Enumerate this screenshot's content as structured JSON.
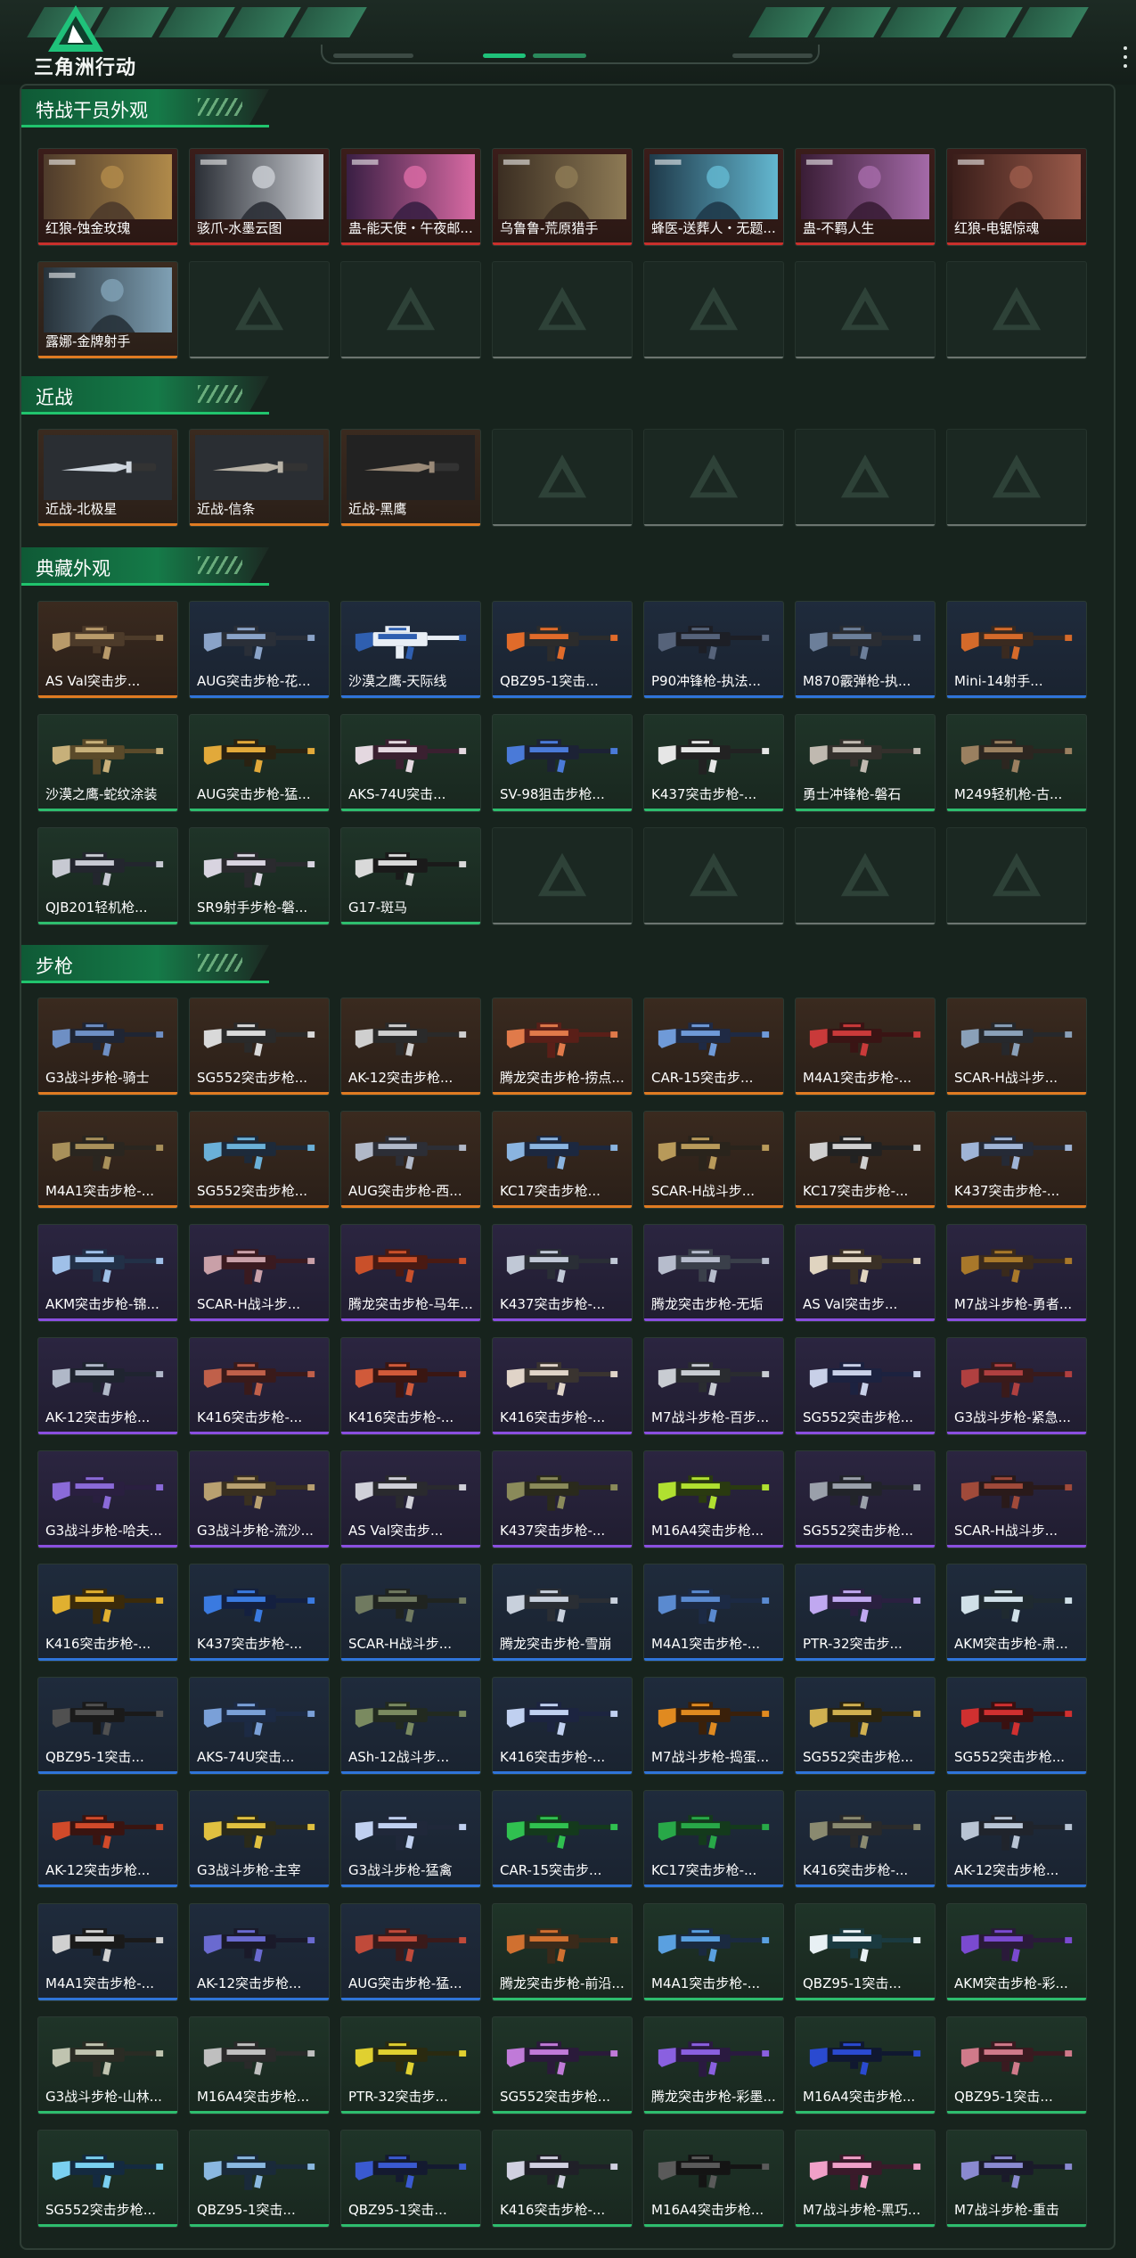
{
  "app": {
    "logo_text": "三角洲行动"
  },
  "sections": [
    {
      "title": "特战干员外观",
      "kind": "portrait",
      "items": [
        {
          "name": "红狼-蚀金玫瑰",
          "rarity": "red",
          "palette": [
            "#4e3b2b",
            "#b08a4a"
          ]
        },
        {
          "name": "骇爪-水墨云图",
          "rarity": "red",
          "palette": [
            "#2b2f36",
            "#c9ccd2"
          ]
        },
        {
          "name": "蛊-能天使・午夜邮...",
          "rarity": "red",
          "palette": [
            "#3a1f44",
            "#d86aa3"
          ]
        },
        {
          "name": "乌鲁鲁-荒原猎手",
          "rarity": "red",
          "palette": [
            "#3b2e22",
            "#8d7a55"
          ]
        },
        {
          "name": "蜂医-送葬人・无题...",
          "rarity": "red",
          "palette": [
            "#1f3a4a",
            "#63b7d0"
          ]
        },
        {
          "name": "蛊-不羁人生",
          "rarity": "red",
          "palette": [
            "#3a1d36",
            "#a46aa8"
          ]
        },
        {
          "name": "红狼-电锯惊魂",
          "rarity": "red",
          "palette": [
            "#3a1e1a",
            "#9a5a4a"
          ]
        },
        {
          "name": "露娜-金牌射手",
          "rarity": "orange",
          "palette": [
            "#27323a",
            "#7fa0b4"
          ]
        }
      ],
      "slots": 14
    },
    {
      "title": "近战",
      "kind": "knife",
      "items": [
        {
          "name": "近战-北极星",
          "rarity": "orange",
          "palette": [
            "#2a2e33",
            "#cfd6de"
          ]
        },
        {
          "name": "近战-信条",
          "rarity": "orange",
          "palette": [
            "#2a2e33",
            "#b8b2a6"
          ]
        },
        {
          "name": "近战-黑鹰",
          "rarity": "orange",
          "palette": [
            "#222",
            "#9a8a78"
          ]
        }
      ],
      "slots": 7
    },
    {
      "title": "典藏外观",
      "kind": "gun",
      "items": [
        {
          "name": "AS Val突击步...",
          "rarity": "orange",
          "palette": [
            "#4d3b2a",
            "#b89a6a"
          ]
        },
        {
          "name": "AUG突击步枪-花...",
          "rarity": "blue",
          "palette": [
            "#2a2f38",
            "#8aa3c8"
          ]
        },
        {
          "name": "沙漠之鹰-天际线",
          "rarity": "blue",
          "palette": [
            "#e8eef5",
            "#2f5fb0"
          ]
        },
        {
          "name": "QBZ95-1突击...",
          "rarity": "blue",
          "palette": [
            "#2c2c2c",
            "#e06b2a"
          ]
        },
        {
          "name": "P90冲锋枪-执法...",
          "rarity": "blue",
          "palette": [
            "#1d1f26",
            "#56637a"
          ]
        },
        {
          "name": "M870霰弹枪-执...",
          "rarity": "blue",
          "palette": [
            "#2a2d33",
            "#6c7f9a"
          ]
        },
        {
          "name": "Mini-14射手...",
          "rarity": "blue",
          "palette": [
            "#3a2a20",
            "#d46a2a"
          ]
        },
        {
          "name": "沙漠之鹰-蛇纹涂装",
          "rarity": "green",
          "palette": [
            "#5a4a2a",
            "#c7b07a"
          ]
        },
        {
          "name": "AUG突击步枪-猛...",
          "rarity": "green",
          "palette": [
            "#2a2212",
            "#e2a93a"
          ]
        },
        {
          "name": "AKS-74U突击...",
          "rarity": "green",
          "palette": [
            "#3a2030",
            "#e4d8e0"
          ]
        },
        {
          "name": "SV-98狙击步枪...",
          "rarity": "green",
          "palette": [
            "#1c2235",
            "#4a7ad8"
          ]
        },
        {
          "name": "K437突击步枪-...",
          "rarity": "green",
          "palette": [
            "#222",
            "#e6e6e6"
          ]
        },
        {
          "name": "勇士冲锋枪-磐石",
          "rarity": "green",
          "palette": [
            "#34302c",
            "#c0b9b0"
          ]
        },
        {
          "name": "M249轻机枪-古...",
          "rarity": "green",
          "palette": [
            "#2c2620",
            "#9a8060"
          ]
        },
        {
          "name": "QJB201轻机枪...",
          "rarity": "green",
          "palette": [
            "#23262e",
            "#c7c9d2"
          ]
        },
        {
          "name": "SR9射手步枪-磐...",
          "rarity": "green",
          "palette": [
            "#2a2a2e",
            "#d8d4e0"
          ]
        },
        {
          "name": "G17-斑马",
          "rarity": "green",
          "palette": [
            "#1a1a1a",
            "#d9d9d9"
          ]
        }
      ],
      "slots": 21
    },
    {
      "title": "步枪",
      "kind": "gun",
      "items": [
        {
          "name": "G3战斗步枪-骑士",
          "rarity": "orange",
          "palette": [
            "#1f2533",
            "#6e8fc4"
          ]
        },
        {
          "name": "SG552突击步枪...",
          "rarity": "orange",
          "palette": [
            "#2a2a2a",
            "#d9d9d9"
          ]
        },
        {
          "name": "AK-12突击步枪...",
          "rarity": "orange",
          "palette": [
            "#2a2a2a",
            "#cfcfcf"
          ]
        },
        {
          "name": "腾龙突击步枪-捞点...",
          "rarity": "orange",
          "palette": [
            "#5a1f18",
            "#e07a4a"
          ]
        },
        {
          "name": "CAR-15突击步...",
          "rarity": "orange",
          "palette": [
            "#1f2a44",
            "#6f9ad8"
          ]
        },
        {
          "name": "M4A1突击步枪-...",
          "rarity": "orange",
          "palette": [
            "#3a1414",
            "#c93a3a"
          ]
        },
        {
          "name": "SCAR-H战斗步...",
          "rarity": "orange",
          "palette": [
            "#26282c",
            "#8aa0b8"
          ]
        },
        {
          "name": "M4A1突击步枪-...",
          "rarity": "orange",
          "palette": [
            "#2a2620",
            "#a8905a"
          ]
        },
        {
          "name": "SG552突击步枪...",
          "rarity": "orange",
          "palette": [
            "#1d2a3a",
            "#6ab0d8"
          ]
        },
        {
          "name": "AUG突击步枪-西...",
          "rarity": "orange",
          "palette": [
            "#2c2e36",
            "#b0b8c8"
          ]
        },
        {
          "name": "KC17突击步枪...",
          "rarity": "orange",
          "palette": [
            "#1c2840",
            "#8ab4e0"
          ]
        },
        {
          "name": "SCAR-H战斗步...",
          "rarity": "orange",
          "palette": [
            "#2a241c",
            "#b89a5a"
          ]
        },
        {
          "name": "KC17突击步枪-...",
          "rarity": "orange",
          "palette": [
            "#222",
            "#cfcfcf"
          ]
        },
        {
          "name": "K437突击步枪-...",
          "rarity": "orange",
          "palette": [
            "#252a36",
            "#9fb4d6"
          ]
        },
        {
          "name": "AKM突击步枪-锦...",
          "rarity": "purple",
          "palette": [
            "#223047",
            "#9fc0e8"
          ]
        },
        {
          "name": "SCAR-H战斗步...",
          "rarity": "purple",
          "palette": [
            "#3a1a20",
            "#c9a0a8"
          ]
        },
        {
          "name": "腾龙突击步枪-马年...",
          "rarity": "purple",
          "palette": [
            "#4a1a12",
            "#c9502a"
          ]
        },
        {
          "name": "K437突击步枪-...",
          "rarity": "purple",
          "palette": [
            "#2a2e36",
            "#c0c8d6"
          ]
        },
        {
          "name": "腾龙突击步枪-无垢",
          "rarity": "purple",
          "palette": [
            "#3a3f4a",
            "#b6bccc"
          ]
        },
        {
          "name": "AS Val突击步...",
          "rarity": "purple",
          "palette": [
            "#3a3026",
            "#e0d4c0"
          ]
        },
        {
          "name": "M7战斗步枪-勇者...",
          "rarity": "purple",
          "palette": [
            "#3a2a1c",
            "#a8782a"
          ]
        },
        {
          "name": "AK-12突击步枪...",
          "rarity": "purple",
          "palette": [
            "#1f2430",
            "#b0b8c8"
          ]
        },
        {
          "name": "K416突击步枪-...",
          "rarity": "purple",
          "palette": [
            "#3a1a1a",
            "#c0604a"
          ]
        },
        {
          "name": "K416突击步枪-...",
          "rarity": "purple",
          "palette": [
            "#3a1612",
            "#d05a3a"
          ]
        },
        {
          "name": "K416突击步枪-...",
          "rarity": "purple",
          "palette": [
            "#3a3430",
            "#e0d4c8"
          ]
        },
        {
          "name": "M7战斗步枪-百步...",
          "rarity": "purple",
          "palette": [
            "#2a2c30",
            "#c8ccd2"
          ]
        },
        {
          "name": "SG552突击步枪...",
          "rarity": "purple",
          "palette": [
            "#1c2240",
            "#c8d0e8"
          ]
        },
        {
          "name": "G3战斗步枪-紧急...",
          "rarity": "purple",
          "palette": [
            "#3a1a1a",
            "#b04040"
          ]
        },
        {
          "name": "G3战斗步枪-哈夫...",
          "rarity": "purple",
          "palette": [
            "#2a1f40",
            "#8a6ad8"
          ]
        },
        {
          "name": "G3战斗步枪-流沙...",
          "rarity": "purple",
          "palette": [
            "#3a3020",
            "#b8a070"
          ]
        },
        {
          "name": "AS Val突击步...",
          "rarity": "purple",
          "palette": [
            "#2a2a2e",
            "#d0d0d8"
          ]
        },
        {
          "name": "K437突击步枪-...",
          "rarity": "purple",
          "palette": [
            "#2a2a1c",
            "#8a8a5a"
          ]
        },
        {
          "name": "M16A4突击步枪...",
          "rarity": "purple",
          "palette": [
            "#2a3a10",
            "#b0e030"
          ]
        },
        {
          "name": "SG552突击步枪...",
          "rarity": "purple",
          "palette": [
            "#22242a",
            "#9aa0aa"
          ]
        },
        {
          "name": "SCAR-H战斗步...",
          "rarity": "purple",
          "palette": [
            "#2a1a1a",
            "#a04a3a"
          ]
        },
        {
          "name": "K416突击步枪-...",
          "rarity": "blue",
          "palette": [
            "#3a2a0a",
            "#e0b030"
          ]
        },
        {
          "name": "K437突击步枪-...",
          "rarity": "blue",
          "palette": [
            "#142040",
            "#3a7ae0"
          ]
        },
        {
          "name": "SCAR-H战斗步...",
          "rarity": "blue",
          "palette": [
            "#202420",
            "#707a60"
          ]
        },
        {
          "name": "腾龙突击步枪-雪崩",
          "rarity": "blue",
          "palette": [
            "#2a2e34",
            "#c8d0dc"
          ]
        },
        {
          "name": "M4A1突击步枪-...",
          "rarity": "blue",
          "palette": [
            "#1c2a44",
            "#5a8ad0"
          ]
        },
        {
          "name": "PTR-32突击步...",
          "rarity": "blue",
          "palette": [
            "#2a2040",
            "#c0a8f0"
          ]
        },
        {
          "name": "AKM突击步枪-肃...",
          "rarity": "blue",
          "palette": [
            "#1f2a30",
            "#d0e0e8"
          ]
        },
        {
          "name": "QBZ95-1突击...",
          "rarity": "blue",
          "palette": [
            "#1a1a1a",
            "#505050"
          ]
        },
        {
          "name": "AKS-74U突击...",
          "rarity": "blue",
          "palette": [
            "#1c2a44",
            "#7aa0d8"
          ]
        },
        {
          "name": "ASh-12战斗步...",
          "rarity": "blue",
          "palette": [
            "#222a20",
            "#7a8a60"
          ]
        },
        {
          "name": "K416突击步枪-...",
          "rarity": "blue",
          "palette": [
            "#1c2440",
            "#c0d0f0"
          ]
        },
        {
          "name": "M7战斗步枪-捣蛋...",
          "rarity": "blue",
          "palette": [
            "#3a200a",
            "#e08a20"
          ]
        },
        {
          "name": "SG552突击步枪...",
          "rarity": "blue",
          "palette": [
            "#2a2410",
            "#d0b050"
          ]
        },
        {
          "name": "SG552突击步枪...",
          "rarity": "blue",
          "palette": [
            "#3a1010",
            "#d03030"
          ]
        },
        {
          "name": "AK-12突击步枪...",
          "rarity": "blue",
          "palette": [
            "#3a1410",
            "#d04a2a"
          ]
        },
        {
          "name": "G3战斗步枪-主宰",
          "rarity": "blue",
          "palette": [
            "#2a2a1a",
            "#e0c040"
          ]
        },
        {
          "name": "G3战斗步枪-猛禽",
          "rarity": "blue",
          "palette": [
            "#20283a",
            "#c0d0f0"
          ]
        },
        {
          "name": "CAR-15突击步...",
          "rarity": "blue",
          "palette": [
            "#143a1c",
            "#30c050"
          ]
        },
        {
          "name": "KC17突击步枪-...",
          "rarity": "blue",
          "palette": [
            "#143a1c",
            "#28a848"
          ]
        },
        {
          "name": "K416突击步枪-...",
          "rarity": "blue",
          "palette": [
            "#2a2a2a",
            "#8a8a70"
          ]
        },
        {
          "name": "AK-12突击步枪...",
          "rarity": "blue",
          "palette": [
            "#20242c",
            "#b8c4d4"
          ]
        },
        {
          "name": "M4A1突击步枪-...",
          "rarity": "blue",
          "palette": [
            "#1a1a1a",
            "#d0d0d0"
          ]
        },
        {
          "name": "AK-12突击步枪...",
          "rarity": "blue",
          "palette": [
            "#1a1a2a",
            "#6a6ad0"
          ]
        },
        {
          "name": "AUG突击步枪-猛...",
          "rarity": "blue",
          "palette": [
            "#3a1a1a",
            "#c04a3a"
          ]
        },
        {
          "name": "腾龙突击步枪-前沿...",
          "rarity": "green",
          "palette": [
            "#3a2a1a",
            "#d07030"
          ]
        },
        {
          "name": "M4A1突击步枪-...",
          "rarity": "green",
          "palette": [
            "#1a2a40",
            "#5aa0e0"
          ]
        },
        {
          "name": "QBZ95-1突击...",
          "rarity": "green",
          "palette": [
            "#1a3a40",
            "#e8f0f4"
          ]
        },
        {
          "name": "AKM突击步枪-彩...",
          "rarity": "green",
          "palette": [
            "#2a1a3a",
            "#7a4ad0"
          ]
        },
        {
          "name": "G3战斗步枪-山林...",
          "rarity": "green",
          "palette": [
            "#2a2c24",
            "#c0c4b0"
          ]
        },
        {
          "name": "M16A4突击步枪...",
          "rarity": "green",
          "palette": [
            "#2a2a2a",
            "#bfbfbf"
          ]
        },
        {
          "name": "PTR-32突击步...",
          "rarity": "green",
          "palette": [
            "#2a2a10",
            "#e0d030"
          ]
        },
        {
          "name": "SG552突击步枪...",
          "rarity": "green",
          "palette": [
            "#2a1a3a",
            "#c07ad8"
          ]
        },
        {
          "name": "腾龙突击步枪-彩墨...",
          "rarity": "green",
          "palette": [
            "#2a1a40",
            "#8a60e0"
          ]
        },
        {
          "name": "M16A4突击步枪...",
          "rarity": "green",
          "palette": [
            "#101830",
            "#2a4ad0"
          ]
        },
        {
          "name": "QBZ95-1突击...",
          "rarity": "green",
          "palette": [
            "#3a1a20",
            "#d07a8a"
          ]
        },
        {
          "name": "SG552突击步枪...",
          "rarity": "green",
          "palette": [
            "#142a40",
            "#7ad0f0"
          ]
        },
        {
          "name": "QBZ95-1突击...",
          "rarity": "green",
          "palette": [
            "#1a2a3a",
            "#8ab8e0"
          ]
        },
        {
          "name": "QBZ95-1突击...",
          "rarity": "green",
          "palette": [
            "#141a30",
            "#3a5ad0"
          ]
        },
        {
          "name": "K416突击步枪-...",
          "rarity": "green",
          "palette": [
            "#202028",
            "#d0d0e0"
          ]
        },
        {
          "name": "M16A4突击步枪...",
          "rarity": "green",
          "palette": [
            "#141414",
            "#5a5a5a"
          ]
        },
        {
          "name": "M7战斗步枪-黑巧...",
          "rarity": "green",
          "palette": [
            "#3a1a2a",
            "#f0a0c8"
          ]
        },
        {
          "name": "M7战斗步枪-重击",
          "rarity": "green",
          "palette": [
            "#1a1a2a",
            "#8a8ad0"
          ]
        }
      ],
      "slots": 77
    }
  ],
  "colors": {
    "accent": "#20c46d",
    "rarity_red": "#c9302c",
    "rarity_orange": "#e07b22",
    "rarity_purple": "#8a4fe0",
    "rarity_blue": "#2f74d9",
    "rarity_green": "#2ebd6e"
  },
  "icons": {
    "logo": "delta-triangle-logo",
    "menu": "kebab-menu-icon",
    "empty": "delta-watermark-icon"
  }
}
